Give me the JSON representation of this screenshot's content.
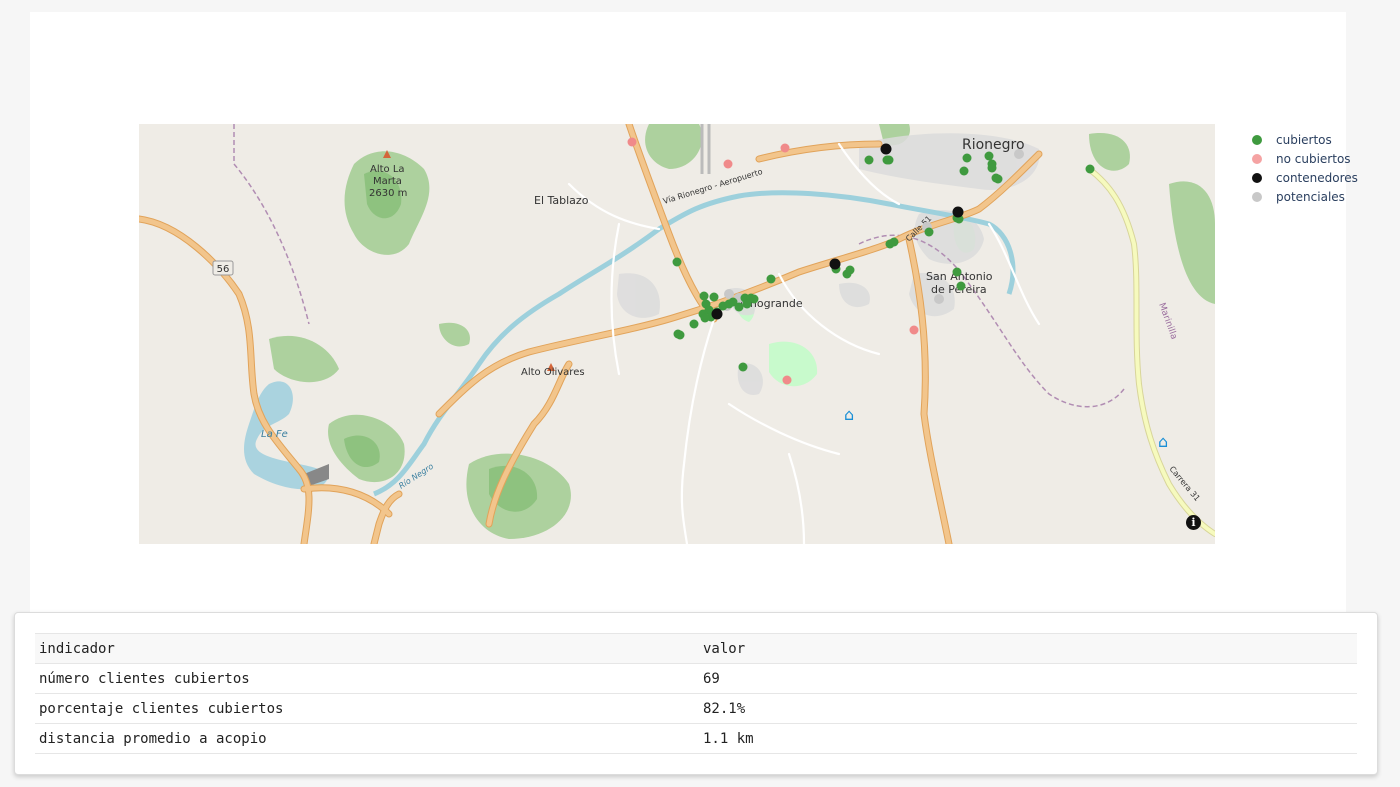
{
  "map": {
    "place_labels": {
      "rionegro": "Rionegro",
      "el_tablazo": "El Tablazo",
      "llanogrande": "Llanogrande",
      "san_antonio_1": "San Antonio",
      "san_antonio_2": "de Pereira",
      "alto_olivares": "Alto Olivares",
      "alto_la_marta_1": "Alto La",
      "alto_la_marta_2": "Marta",
      "alto_la_marta_3": "2630 m",
      "la_fe": "La Fe",
      "via_aeropuerto": "Vía Rionegro - Aeropuerto",
      "rio_negro": "Río Negro",
      "route_56": "56",
      "calle_51": "Calle 51",
      "carrera_31": "Carrera 31",
      "marinilla": "Marinilla"
    },
    "colors": {
      "land": "#efece6",
      "forest": "#add19e",
      "forest_dark": "#8ec27f",
      "water": "#aad3df",
      "river": "#9dd0dc",
      "road_major": "#f2c58c",
      "road_major_casing": "#e1a35a",
      "road_trunk": "#f6fabe",
      "built": "#dddddd",
      "park": "#c8facc",
      "admin_boundary": "#b18db3"
    }
  },
  "legend": {
    "items": [
      {
        "label": "cubiertos",
        "color": "#3f9a3f"
      },
      {
        "label": "no cubiertos",
        "color": "#f5a3a3"
      },
      {
        "label": "contenedores",
        "color": "#111111"
      },
      {
        "label": "potenciales",
        "color": "#c8c8c8"
      }
    ]
  },
  "table": {
    "headers": [
      "indicador",
      "valor"
    ],
    "rows": [
      [
        "número clientes cubiertos",
        "69"
      ],
      [
        "porcentaje clientes cubiertos",
        "82.1%"
      ],
      [
        "distancia promedio a acopio",
        "1.1 km"
      ]
    ]
  }
}
